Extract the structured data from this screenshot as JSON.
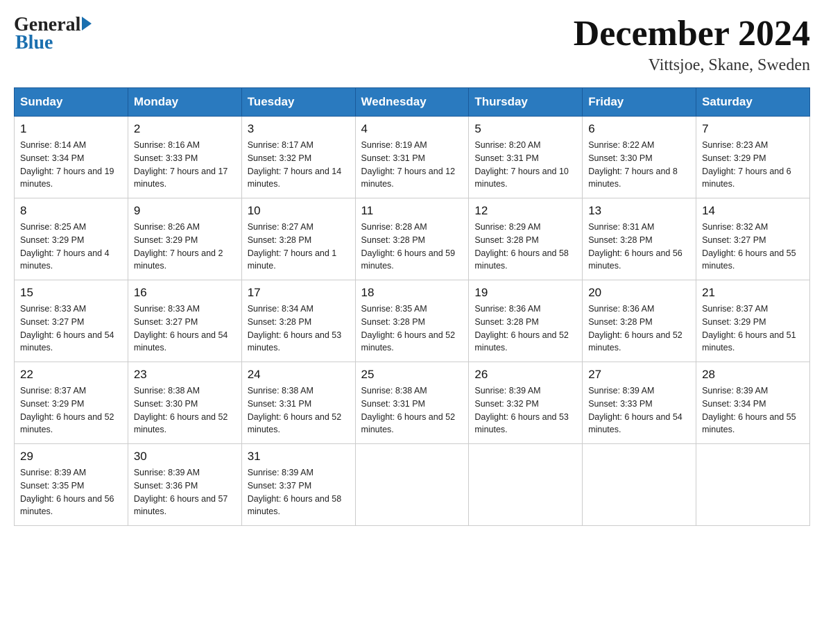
{
  "header": {
    "month_year": "December 2024",
    "location": "Vittsjoe, Skane, Sweden",
    "logo_general": "General",
    "logo_blue": "Blue"
  },
  "days_of_week": [
    "Sunday",
    "Monday",
    "Tuesday",
    "Wednesday",
    "Thursday",
    "Friday",
    "Saturday"
  ],
  "weeks": [
    [
      {
        "day": "1",
        "sunrise": "8:14 AM",
        "sunset": "3:34 PM",
        "daylight": "7 hours and 19 minutes."
      },
      {
        "day": "2",
        "sunrise": "8:16 AM",
        "sunset": "3:33 PM",
        "daylight": "7 hours and 17 minutes."
      },
      {
        "day": "3",
        "sunrise": "8:17 AM",
        "sunset": "3:32 PM",
        "daylight": "7 hours and 14 minutes."
      },
      {
        "day": "4",
        "sunrise": "8:19 AM",
        "sunset": "3:31 PM",
        "daylight": "7 hours and 12 minutes."
      },
      {
        "day": "5",
        "sunrise": "8:20 AM",
        "sunset": "3:31 PM",
        "daylight": "7 hours and 10 minutes."
      },
      {
        "day": "6",
        "sunrise": "8:22 AM",
        "sunset": "3:30 PM",
        "daylight": "7 hours and 8 minutes."
      },
      {
        "day": "7",
        "sunrise": "8:23 AM",
        "sunset": "3:29 PM",
        "daylight": "7 hours and 6 minutes."
      }
    ],
    [
      {
        "day": "8",
        "sunrise": "8:25 AM",
        "sunset": "3:29 PM",
        "daylight": "7 hours and 4 minutes."
      },
      {
        "day": "9",
        "sunrise": "8:26 AM",
        "sunset": "3:29 PM",
        "daylight": "7 hours and 2 minutes."
      },
      {
        "day": "10",
        "sunrise": "8:27 AM",
        "sunset": "3:28 PM",
        "daylight": "7 hours and 1 minute."
      },
      {
        "day": "11",
        "sunrise": "8:28 AM",
        "sunset": "3:28 PM",
        "daylight": "6 hours and 59 minutes."
      },
      {
        "day": "12",
        "sunrise": "8:29 AM",
        "sunset": "3:28 PM",
        "daylight": "6 hours and 58 minutes."
      },
      {
        "day": "13",
        "sunrise": "8:31 AM",
        "sunset": "3:28 PM",
        "daylight": "6 hours and 56 minutes."
      },
      {
        "day": "14",
        "sunrise": "8:32 AM",
        "sunset": "3:27 PM",
        "daylight": "6 hours and 55 minutes."
      }
    ],
    [
      {
        "day": "15",
        "sunrise": "8:33 AM",
        "sunset": "3:27 PM",
        "daylight": "6 hours and 54 minutes."
      },
      {
        "day": "16",
        "sunrise": "8:33 AM",
        "sunset": "3:27 PM",
        "daylight": "6 hours and 54 minutes."
      },
      {
        "day": "17",
        "sunrise": "8:34 AM",
        "sunset": "3:28 PM",
        "daylight": "6 hours and 53 minutes."
      },
      {
        "day": "18",
        "sunrise": "8:35 AM",
        "sunset": "3:28 PM",
        "daylight": "6 hours and 52 minutes."
      },
      {
        "day": "19",
        "sunrise": "8:36 AM",
        "sunset": "3:28 PM",
        "daylight": "6 hours and 52 minutes."
      },
      {
        "day": "20",
        "sunrise": "8:36 AM",
        "sunset": "3:28 PM",
        "daylight": "6 hours and 52 minutes."
      },
      {
        "day": "21",
        "sunrise": "8:37 AM",
        "sunset": "3:29 PM",
        "daylight": "6 hours and 51 minutes."
      }
    ],
    [
      {
        "day": "22",
        "sunrise": "8:37 AM",
        "sunset": "3:29 PM",
        "daylight": "6 hours and 52 minutes."
      },
      {
        "day": "23",
        "sunrise": "8:38 AM",
        "sunset": "3:30 PM",
        "daylight": "6 hours and 52 minutes."
      },
      {
        "day": "24",
        "sunrise": "8:38 AM",
        "sunset": "3:31 PM",
        "daylight": "6 hours and 52 minutes."
      },
      {
        "day": "25",
        "sunrise": "8:38 AM",
        "sunset": "3:31 PM",
        "daylight": "6 hours and 52 minutes."
      },
      {
        "day": "26",
        "sunrise": "8:39 AM",
        "sunset": "3:32 PM",
        "daylight": "6 hours and 53 minutes."
      },
      {
        "day": "27",
        "sunrise": "8:39 AM",
        "sunset": "3:33 PM",
        "daylight": "6 hours and 54 minutes."
      },
      {
        "day": "28",
        "sunrise": "8:39 AM",
        "sunset": "3:34 PM",
        "daylight": "6 hours and 55 minutes."
      }
    ],
    [
      {
        "day": "29",
        "sunrise": "8:39 AM",
        "sunset": "3:35 PM",
        "daylight": "6 hours and 56 minutes."
      },
      {
        "day": "30",
        "sunrise": "8:39 AM",
        "sunset": "3:36 PM",
        "daylight": "6 hours and 57 minutes."
      },
      {
        "day": "31",
        "sunrise": "8:39 AM",
        "sunset": "3:37 PM",
        "daylight": "6 hours and 58 minutes."
      },
      null,
      null,
      null,
      null
    ]
  ],
  "labels": {
    "sunrise_prefix": "Sunrise: ",
    "sunset_prefix": "Sunset: ",
    "daylight_prefix": "Daylight: "
  }
}
